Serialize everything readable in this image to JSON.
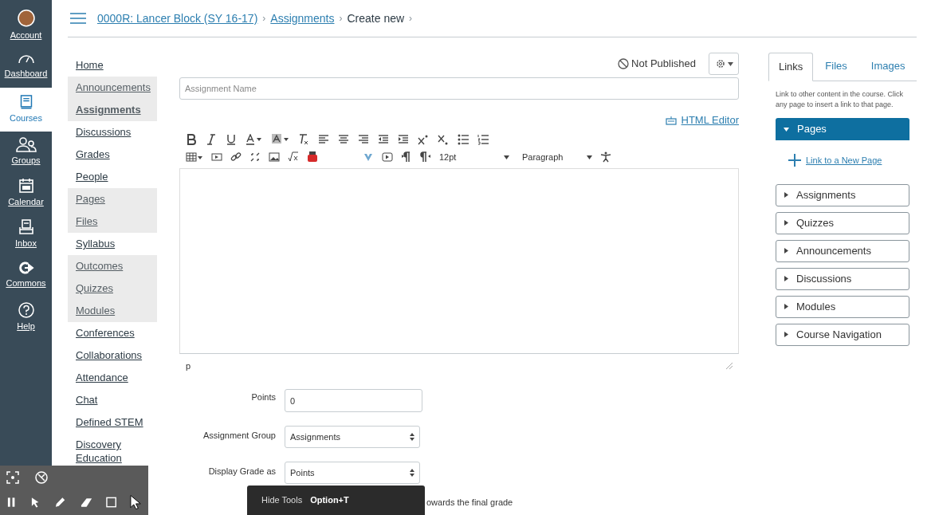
{
  "global_nav": [
    {
      "kind": "avatar",
      "label": "Account",
      "selected": false
    },
    {
      "kind": "dashboard",
      "label": "Dashboard",
      "selected": false
    },
    {
      "kind": "courses",
      "label": "Courses",
      "selected": true
    },
    {
      "kind": "groups",
      "label": "Groups",
      "selected": false
    },
    {
      "kind": "calendar",
      "label": "Calendar",
      "selected": false
    },
    {
      "kind": "inbox",
      "label": "Inbox",
      "selected": false
    },
    {
      "kind": "commons",
      "label": "Commons",
      "selected": false
    },
    {
      "kind": "help",
      "label": "Help",
      "selected": false
    }
  ],
  "breadcrumbs": [
    {
      "kind": "link",
      "label": "0000R: Lancer Block (SY 16-17)"
    },
    {
      "kind": "separator",
      "label": "›"
    },
    {
      "kind": "link",
      "label": "Assignments"
    },
    {
      "kind": "separator",
      "label": "›"
    },
    {
      "kind": "current",
      "label": "Create new"
    },
    {
      "kind": "separator",
      "label": "›"
    }
  ],
  "course_nav": [
    {
      "label": "Home",
      "hidden": false,
      "selected": false
    },
    {
      "label": "Announcements",
      "hidden": true,
      "selected": false
    },
    {
      "label": "Assignments",
      "hidden": true,
      "selected": true
    },
    {
      "label": "Discussions",
      "hidden": false,
      "selected": false
    },
    {
      "label": "Grades",
      "hidden": false,
      "selected": false
    },
    {
      "label": "People",
      "hidden": false,
      "selected": false
    },
    {
      "label": "Pages",
      "hidden": true,
      "selected": false
    },
    {
      "label": "Files",
      "hidden": true,
      "selected": false
    },
    {
      "label": "Syllabus",
      "hidden": false,
      "selected": false
    },
    {
      "label": "Outcomes",
      "hidden": true,
      "selected": false
    },
    {
      "label": "Quizzes",
      "hidden": true,
      "selected": false
    },
    {
      "label": "Modules",
      "hidden": true,
      "selected": false
    },
    {
      "label": "Conferences",
      "hidden": false,
      "selected": false
    },
    {
      "label": "Collaborations",
      "hidden": false,
      "selected": false
    },
    {
      "label": "Attendance",
      "hidden": false,
      "selected": false
    },
    {
      "label": "Chat",
      "hidden": false,
      "selected": false
    },
    {
      "label": "Defined STEM",
      "hidden": false,
      "selected": false
    },
    {
      "label": "Discovery Education",
      "hidden": false,
      "selected": false
    }
  ],
  "publish_status": "Not Published",
  "assignment_name": {
    "placeholder": "Assignment Name"
  },
  "html_editor_link": "HTML Editor",
  "editor": {
    "font_size": "12pt",
    "block_format": "Paragraph",
    "path": "p"
  },
  "fields": [
    {
      "kind": "input",
      "label": "Points",
      "value": "0"
    },
    {
      "kind": "select",
      "label": "Assignment Group",
      "value": "Assignments"
    },
    {
      "kind": "select",
      "label": "Display Grade as",
      "value": "Points"
    }
  ],
  "partial_text": "owards the final grade",
  "side_tabs": [
    {
      "label": "Links",
      "selected": true
    },
    {
      "label": "Files",
      "selected": false
    },
    {
      "label": "Images",
      "selected": false
    }
  ],
  "side_description": "Link to other content in the course. Click any page to insert a link to that page.",
  "side_sections": [
    {
      "label": "Pages",
      "expanded": true
    },
    {
      "label": "Assignments",
      "expanded": false
    },
    {
      "label": "Quizzes",
      "expanded": false
    },
    {
      "label": "Announcements",
      "expanded": false
    },
    {
      "label": "Discussions",
      "expanded": false
    },
    {
      "label": "Modules",
      "expanded": false
    },
    {
      "label": "Course Navigation",
      "expanded": false
    }
  ],
  "new_page_link": "Link to a New Page",
  "tooltip": {
    "label": "Hide Tools",
    "shortcut": "Option+T"
  }
}
